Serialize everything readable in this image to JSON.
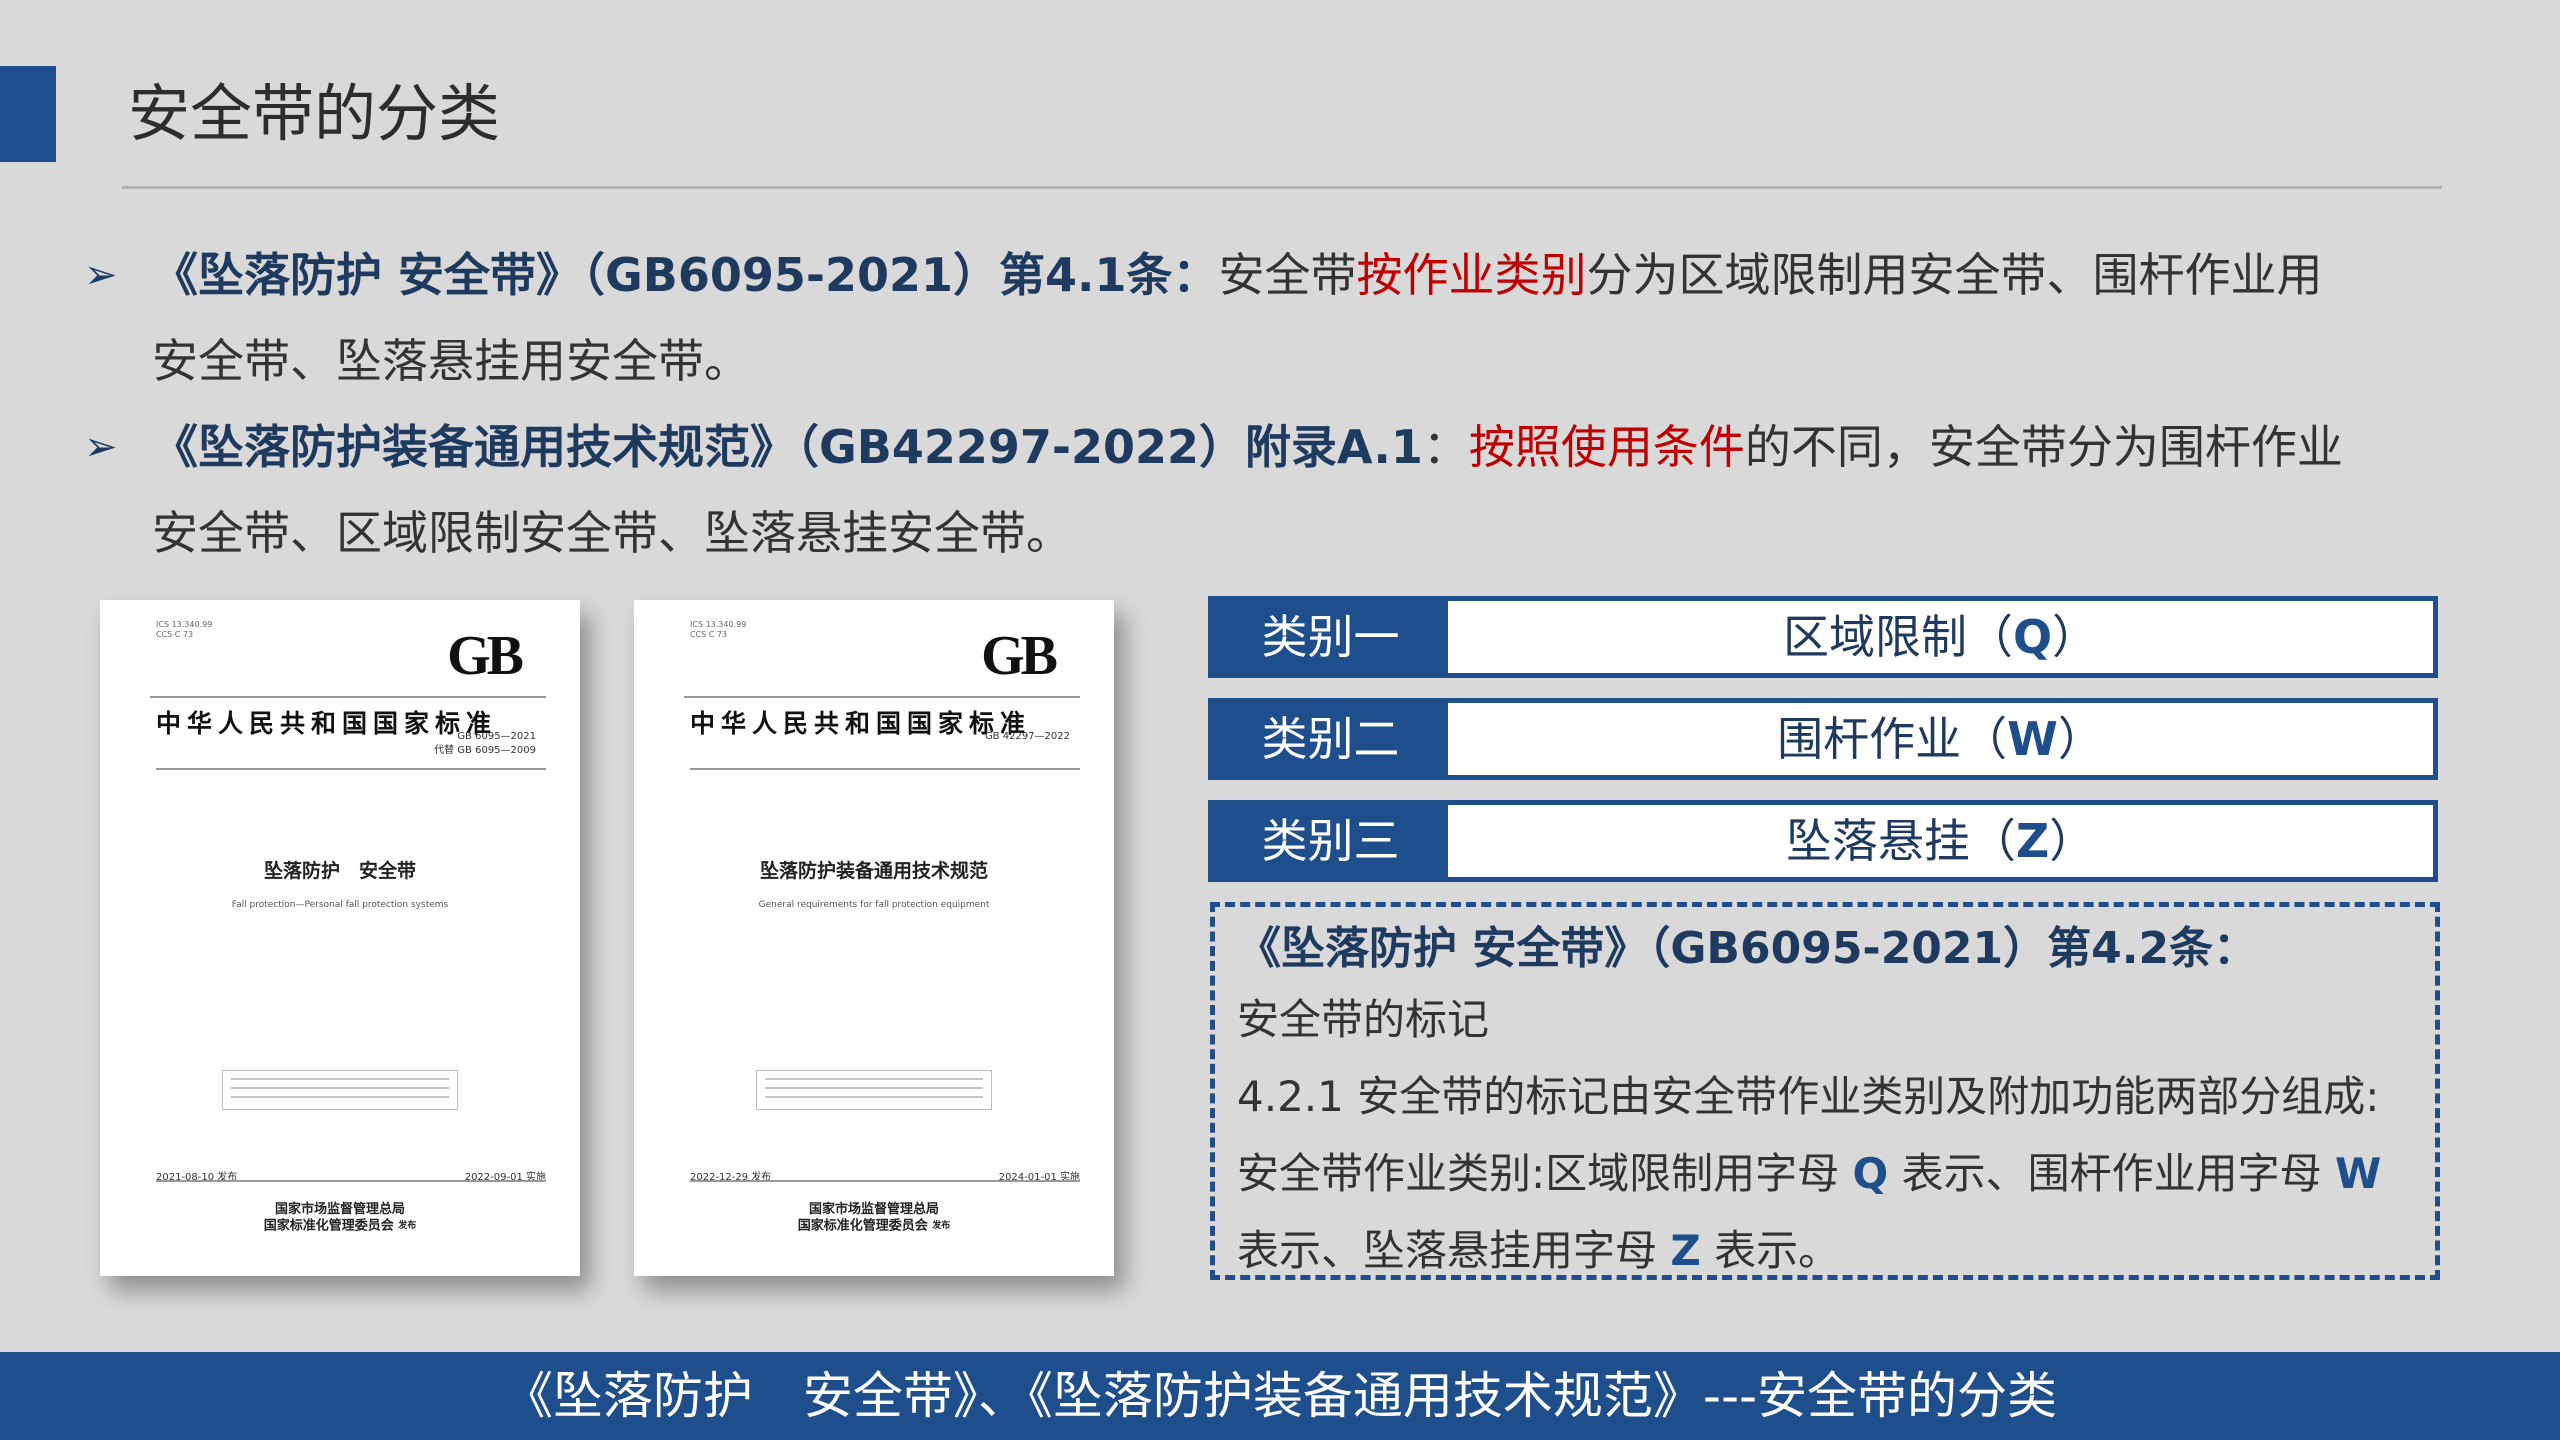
{
  "title": "安全带的分类",
  "bullets": [
    {
      "ref": "《坠落防护 安全带》（GB6095-2021）第4.1条：",
      "pre": "安全带",
      "highlight": "按作业类别",
      "post": "分为区域限制用安全带、围杆作业用",
      "cont": "安全带、坠落悬挂用安全带。"
    },
    {
      "ref": "《坠落防护装备通用技术规范》（GB42297-2022）附录A.1",
      "sep": "：",
      "highlight": "按照使用条件",
      "post": "的不同，安全带分为围杆作业",
      "cont": "安全带、区域限制安全带、坠落悬挂安全带。"
    }
  ],
  "documents": [
    {
      "ics": "ICS 13.340.99",
      "ccs": "CCS C 73",
      "logo": "GB",
      "standard": "中华人民共和国国家标准",
      "number": "GB 6095—2021",
      "replaces": "代替 GB 6095—2009",
      "name": "坠落防护　安全带",
      "name_en": "Fall protection—Personal fall protection systems",
      "published": "2021-08-10 发布",
      "effective": "2022-09-01 实施",
      "issuer_1": "国家市场监督管理总局",
      "issuer_2": "国家标准化管理委员会",
      "issue": "发布"
    },
    {
      "ics": "ICS 13.340.99",
      "ccs": "CCS C 73",
      "logo": "GB",
      "standard": "中华人民共和国国家标准",
      "number": "GB 42297—2022",
      "replaces": "",
      "name": "坠落防护装备通用技术规范",
      "name_en": "General requirements for fall protection equipment",
      "published": "2022-12-29 发布",
      "effective": "2024-01-01 实施",
      "issuer_1": "国家市场监督管理总局",
      "issuer_2": "国家标准化管理委员会",
      "issue": "发布"
    }
  ],
  "categories": [
    {
      "label": "类别一",
      "name": "区域限制（",
      "code": "Q",
      "close": "）"
    },
    {
      "label": "类别二",
      "name": "围杆作业（",
      "code": "W",
      "close": "）"
    },
    {
      "label": "类别三",
      "name": "坠落悬挂（",
      "code": "Z",
      "close": "）"
    }
  ],
  "note": {
    "heading": "《坠落防护 安全带》（GB6095-2021）第4.2条：",
    "line1": "安全带的标记",
    "line2": "4.2.1 安全带的标记由安全带作业类别及附加功能两部分组成:",
    "line3_a": "安全带作业类别:区域限制用字母 ",
    "line3_q": "Q",
    "line3_b": " 表示、围杆作业用字母 ",
    "line3_w": "W",
    "line4_a": "表示、坠落悬挂用字母 ",
    "line4_z": "Z",
    "line4_b": " 表示。"
  },
  "footer": "《坠落防护　安全带》、《坠落防护装备通用技术规范》---安全带的分类",
  "colors": {
    "primary": "#1f4e8c",
    "highlight": "#c00000",
    "background": "#d9d9d9"
  }
}
